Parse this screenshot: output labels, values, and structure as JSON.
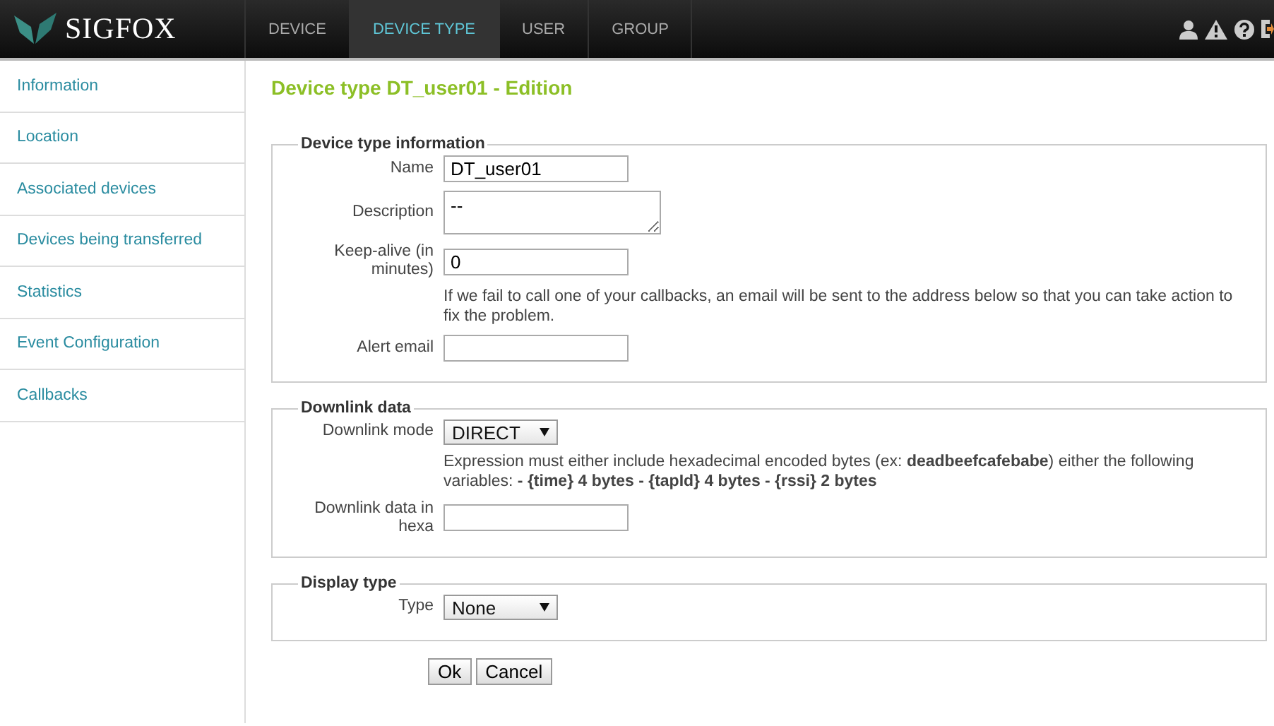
{
  "header": {
    "logo": "SIGFOX",
    "tabs": [
      {
        "label": "DEVICE",
        "selected": false
      },
      {
        "label": "DEVICE TYPE",
        "selected": true
      },
      {
        "label": "USER",
        "selected": false
      },
      {
        "label": "GROUP",
        "selected": false
      }
    ]
  },
  "sidebar": {
    "items": [
      {
        "label": "Information"
      },
      {
        "label": "Location"
      },
      {
        "label": "Associated devices"
      },
      {
        "label": "Devices being transferred"
      },
      {
        "label": "Statistics"
      },
      {
        "label": "Event Configuration"
      },
      {
        "label": "Callbacks"
      }
    ]
  },
  "title": "Device type DT_user01 - Edition",
  "sections": [
    {
      "legend": "Device type information",
      "rows": [
        {
          "kind": "text",
          "label": "Name",
          "value": "DT_user01"
        },
        {
          "kind": "textarea",
          "label": "Description",
          "value": "--"
        },
        {
          "kind": "text",
          "label": "Keep-alive (in minutes)",
          "value": "0"
        },
        {
          "kind": "note",
          "text": "If we fail to call one of your callbacks, an email will be sent to the address below so that you can take action to fix the problem."
        },
        {
          "kind": "text",
          "label": "Alert email",
          "value": ""
        }
      ]
    },
    {
      "legend": "Downlink data",
      "rows": [
        {
          "kind": "select",
          "label": "Downlink mode",
          "value": "DIRECT"
        },
        {
          "kind": "note",
          "text": "Expression must either include hexadecimal encoded bytes (ex: **deadbeefcafebabe**) either the following variables: **- {time} 4 bytes - {tapId} 4 bytes - {rssi} 2 bytes**"
        },
        {
          "kind": "text",
          "label": "Downlink data in hexa",
          "value": ""
        }
      ]
    },
    {
      "legend": "Display type",
      "rows": [
        {
          "kind": "select",
          "label": "Type",
          "value": "None"
        }
      ]
    }
  ],
  "buttons": [
    "Ok",
    "Cancel"
  ]
}
